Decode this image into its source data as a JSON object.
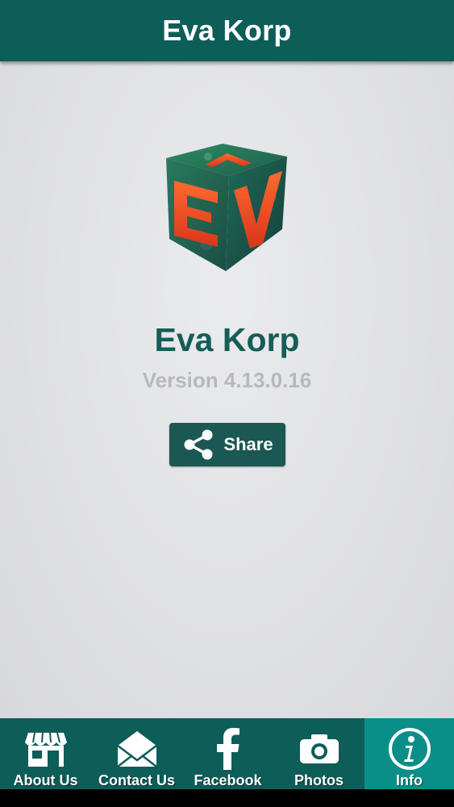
{
  "header": {
    "title": "Eva Korp"
  },
  "about": {
    "app_name": "Eva Korp",
    "version": "Version 4.13.0.16",
    "share_label": "Share"
  },
  "tabs": [
    {
      "label": "About Us",
      "icon": "storefront-icon",
      "active": false
    },
    {
      "label": "Contact Us",
      "icon": "envelope-icon",
      "active": false
    },
    {
      "label": "Facebook",
      "icon": "facebook-icon",
      "active": false
    },
    {
      "label": "Photos",
      "icon": "camera-icon",
      "active": false
    },
    {
      "label": "Info",
      "icon": "info-icon",
      "active": true
    }
  ],
  "colors": {
    "header_bg": "#0d5d59",
    "active_tab": "#0a8f88",
    "app_name": "#155e58",
    "version_text": "#b7b8ba",
    "share_bg": "#1b5753"
  }
}
